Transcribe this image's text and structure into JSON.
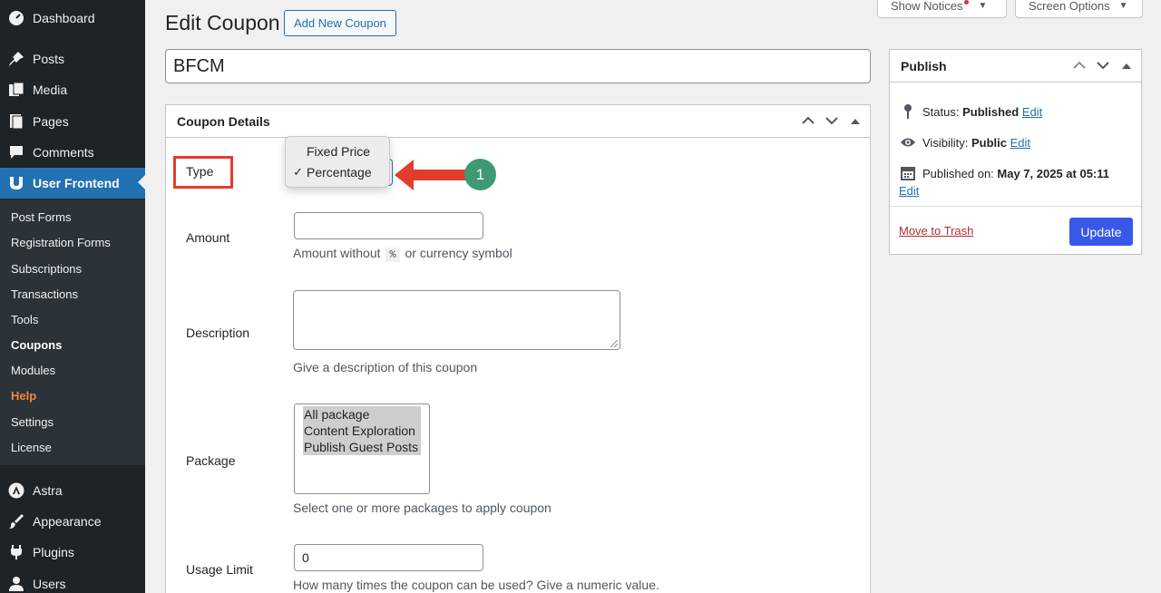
{
  "sidebar": {
    "top_items": [
      {
        "label": "Dashboard",
        "icon": "dashboard-icon"
      },
      {
        "label": "Posts",
        "icon": "pin-icon"
      },
      {
        "label": "Media",
        "icon": "media-icon"
      },
      {
        "label": "Pages",
        "icon": "pages-icon"
      },
      {
        "label": "Comments",
        "icon": "comment-icon"
      },
      {
        "label": "User Frontend",
        "icon": "user-frontend-icon"
      }
    ],
    "submenu": [
      "Post Forms",
      "Registration Forms",
      "Subscriptions",
      "Transactions",
      "Tools",
      "Coupons",
      "Modules",
      "Help",
      "Settings",
      "License"
    ],
    "bottom_items": [
      {
        "label": "Astra",
        "icon": "astra-icon"
      },
      {
        "label": "Appearance",
        "icon": "paintbrush-icon"
      },
      {
        "label": "Plugins",
        "icon": "plugin-icon"
      },
      {
        "label": "Users",
        "icon": "users-icon"
      }
    ],
    "colors": {
      "bg": "#1d2327",
      "active": "#2271b1",
      "help": "#f0883e"
    }
  },
  "top_buttons": {
    "notices": "Show Notices",
    "screen_options": "Screen Options"
  },
  "page": {
    "title": "Edit Coupon",
    "add_new": "Add New Coupon",
    "coupon_title": "BFCM"
  },
  "details": {
    "header": "Coupon Details",
    "type_label": "Type",
    "type_options": [
      "Fixed Price",
      "Percentage"
    ],
    "type_selected": "Percentage",
    "check_mark": "✓",
    "step_number": "1",
    "amount_label": "Amount",
    "amount_value": "",
    "amount_help_before": "Amount without",
    "amount_help_code": "%",
    "amount_help_after": "or currency symbol",
    "description_label": "Description",
    "description_help": "Give a description of this coupon",
    "package_label": "Package",
    "package_options": [
      "All package",
      "Content Exploration",
      "Publish Guest Posts"
    ],
    "package_help": "Select one or more packages to apply coupon",
    "usage_label": "Usage Limit",
    "usage_value": "0",
    "usage_help": "How many times the coupon can be used? Give a numeric value."
  },
  "publish": {
    "header": "Publish",
    "status_label": "Status:",
    "status_value": "Published",
    "visibility_label": "Visibility:",
    "visibility_value": "Public",
    "published_label": "Published on:",
    "published_value": "May 7, 2025 at 05:11",
    "edit": "Edit",
    "trash": "Move to Trash",
    "update": "Update"
  }
}
